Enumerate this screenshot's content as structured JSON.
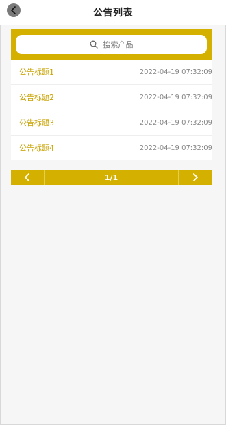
{
  "header": {
    "title": "公告列表"
  },
  "search": {
    "placeholder": "搜索产品"
  },
  "announcements": [
    {
      "title": "公告标题1",
      "time": "2022-04-19 07:32:09"
    },
    {
      "title": "公告标题2",
      "time": "2022-04-19 07:32:09"
    },
    {
      "title": "公告标题3",
      "time": "2022-04-19 07:32:09"
    },
    {
      "title": "公告标题4",
      "time": "2022-04-19 07:32:09"
    }
  ],
  "pagination": {
    "info": "1/1"
  },
  "colors": {
    "accent": "#d4b100",
    "title_text": "#c8a200"
  },
  "icons": {
    "back": "back-arrow-icon",
    "search": "search-icon",
    "prev": "chevron-left-icon",
    "next": "chevron-right-icon"
  }
}
